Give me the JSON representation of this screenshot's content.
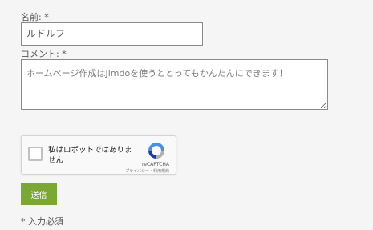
{
  "form": {
    "name_label": "名前: *",
    "name_value": "ルドルフ",
    "comment_label": "コメント: *",
    "comment_placeholder": "ホームページ作成はJimdoを使うととってもかんたんにできます！",
    "recaptcha": {
      "label": "私はロボットではありません",
      "brand": "reCAPTCHA",
      "links": "プライバシー・利用規約",
      "logo_colors": {
        "blue": "#4a90e2",
        "dark_blue": "#1c3aa9",
        "gray": "#b0b0b0"
      }
    },
    "submit_label": "送信",
    "required_note": "* 入力必須"
  },
  "colors": {
    "background": "#f4f5f4",
    "submit": "#7aa832"
  }
}
